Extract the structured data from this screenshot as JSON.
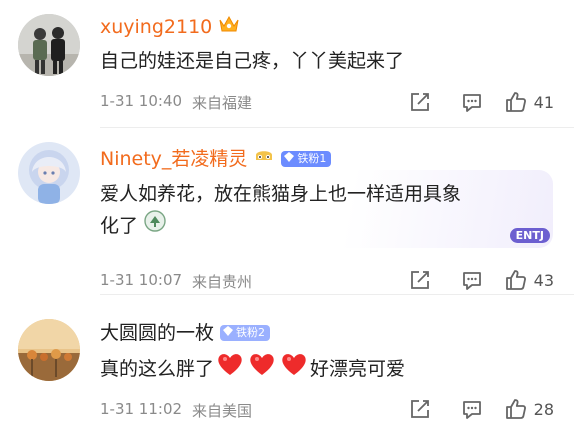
{
  "comments": [
    {
      "username": "xuying2110",
      "text": "自己的娃还是自己疼，丫丫美起来了",
      "date": "1-31 10:40",
      "location": "来自福建",
      "likes": "41",
      "badge_icon": "crown-icon",
      "name_color": "#f26b1d"
    },
    {
      "username": "Ninety_若凌精灵",
      "text_line1": "爱人如养花，放在熊猫身上也一样适用具象",
      "text_line2": "化了",
      "fan_badge": "铁粉1",
      "sticker_text": "ENTJ",
      "date": "1-31 10:07",
      "location": "来自贵州",
      "likes": "43",
      "name_color": "#f26b1d"
    },
    {
      "username": "大圆圆的一枚",
      "fan_badge": "铁粉2",
      "text_before": "真的这么胖了",
      "text_after": "好漂亮可爱",
      "date": "1-31 11:02",
      "location": "来自美国",
      "likes": "28",
      "name_color": "#222222"
    }
  ]
}
